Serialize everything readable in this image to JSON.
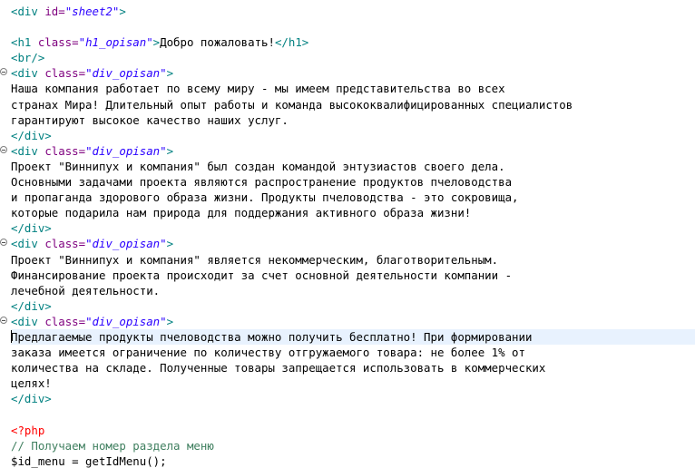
{
  "editor": {
    "lines": [
      {
        "segments": [
          {
            "t": "<div ",
            "c": "tag"
          },
          {
            "t": "id=",
            "c": "attr"
          },
          {
            "t": "\"sheet2\"",
            "c": "val"
          },
          {
            "t": ">",
            "c": "tag"
          }
        ]
      },
      {
        "segments": []
      },
      {
        "segments": [
          {
            "t": "<h1 ",
            "c": "tag"
          },
          {
            "t": "class=",
            "c": "attr"
          },
          {
            "t": "\"h1_opisan\"",
            "c": "val"
          },
          {
            "t": ">",
            "c": "tag"
          },
          {
            "t": "Добро пожаловать!",
            "c": "plain"
          },
          {
            "t": "</h1>",
            "c": "tag"
          }
        ]
      },
      {
        "segments": [
          {
            "t": "<br/>",
            "c": "tag"
          }
        ]
      },
      {
        "fold": true,
        "segments": [
          {
            "t": "<div ",
            "c": "tag"
          },
          {
            "t": "class=",
            "c": "attr"
          },
          {
            "t": "\"div_opisan\"",
            "c": "val"
          },
          {
            "t": ">",
            "c": "tag"
          }
        ]
      },
      {
        "segments": [
          {
            "t": "Наша компания работает по всему миру - мы имеем представительства во всех",
            "c": "plain"
          }
        ]
      },
      {
        "segments": [
          {
            "t": "странах Мира! Длительный опыт работы и команда высококвалифицированных специалистов",
            "c": "plain"
          }
        ]
      },
      {
        "segments": [
          {
            "t": "гарантируют высокое качество наших услуг.",
            "c": "plain"
          }
        ]
      },
      {
        "segments": [
          {
            "t": "</div>",
            "c": "tag"
          }
        ]
      },
      {
        "fold": true,
        "segments": [
          {
            "t": "<div ",
            "c": "tag"
          },
          {
            "t": "class=",
            "c": "attr"
          },
          {
            "t": "\"div_opisan\"",
            "c": "val"
          },
          {
            "t": ">",
            "c": "tag"
          }
        ]
      },
      {
        "segments": [
          {
            "t": "Проект \"Виннипух и компания\" был создан командой энтузиастов своего дела.",
            "c": "plain"
          }
        ]
      },
      {
        "segments": [
          {
            "t": "Основными задачами проекта являются распространение продуктов пчеловодства",
            "c": "plain"
          }
        ]
      },
      {
        "segments": [
          {
            "t": "и пропаганда здорового образа жизни. Продукты пчеловодства - это сокровища,",
            "c": "plain"
          }
        ]
      },
      {
        "segments": [
          {
            "t": "которые подарила нам природа для поддержания активного образа жизни!",
            "c": "plain"
          }
        ]
      },
      {
        "segments": [
          {
            "t": "</div>",
            "c": "tag"
          }
        ]
      },
      {
        "fold": true,
        "segments": [
          {
            "t": "<div ",
            "c": "tag"
          },
          {
            "t": "class=",
            "c": "attr"
          },
          {
            "t": "\"div_opisan\"",
            "c": "val"
          },
          {
            "t": ">",
            "c": "tag"
          }
        ]
      },
      {
        "segments": [
          {
            "t": "Проект \"Виннипух и компания\" является некоммерческим, благотворительным.",
            "c": "plain"
          }
        ]
      },
      {
        "segments": [
          {
            "t": "Финансирование проекта происходит за счет основной деятельности компании -",
            "c": "plain"
          }
        ]
      },
      {
        "segments": [
          {
            "t": "лечебной деятельности.",
            "c": "plain"
          }
        ]
      },
      {
        "segments": [
          {
            "t": "</div>",
            "c": "tag"
          }
        ]
      },
      {
        "fold": true,
        "segments": [
          {
            "t": "<div ",
            "c": "tag"
          },
          {
            "t": "class=",
            "c": "attr"
          },
          {
            "t": "\"div_opisan\"",
            "c": "val"
          },
          {
            "t": ">",
            "c": "tag"
          }
        ]
      },
      {
        "current": true,
        "caret": true,
        "segments": [
          {
            "t": "Предлагаемые продукты пчеловодства можно получить бесплатно! При формировании",
            "c": "plain"
          }
        ]
      },
      {
        "segments": [
          {
            "t": "заказа имеется ограничение по количеству отгружаемого товара: не более 1% от",
            "c": "plain"
          }
        ]
      },
      {
        "segments": [
          {
            "t": "количества на складе. Полученные товары запрещается использовать в коммерческих",
            "c": "plain"
          }
        ]
      },
      {
        "segments": [
          {
            "t": "целях!",
            "c": "plain"
          }
        ]
      },
      {
        "segments": [
          {
            "t": "</div>",
            "c": "tag"
          }
        ]
      },
      {
        "segments": []
      },
      {
        "segments": [
          {
            "t": "<?php",
            "c": "php"
          }
        ]
      },
      {
        "segments": [
          {
            "t": "// Получаем номер раздела меню",
            "c": "comment"
          }
        ]
      },
      {
        "segments": [
          {
            "t": "$id_menu = getIdMenu();",
            "c": "plain"
          }
        ]
      }
    ]
  }
}
